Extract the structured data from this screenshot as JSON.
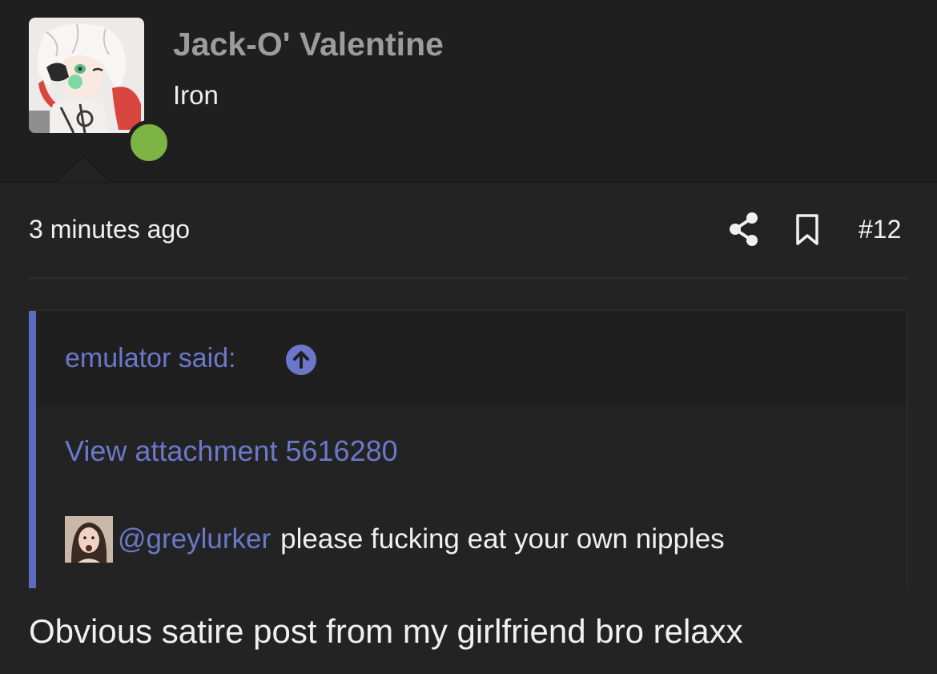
{
  "user": {
    "name": "Jack-O' Valentine",
    "title": "Iron",
    "status": "online",
    "status_color": "#7cb342",
    "avatar_icon": "anime-character-avatar"
  },
  "post": {
    "timestamp": "3 minutes ago",
    "number": "#12",
    "actions": [
      "share-icon",
      "bookmark-icon"
    ],
    "body": "Obvious satire post from my girlfriend bro relaxx"
  },
  "quote": {
    "author_label": "emulator said:",
    "jump_icon": "arrow-up-circle-icon",
    "attachment_link": "View attachment 5616280",
    "mention": "@greylurker",
    "message": "please fucking eat your own nipples"
  },
  "colors": {
    "background": "#232324",
    "header_background": "#1f1f20",
    "link": "#6b78c9",
    "quote_bar": "#5c6bc0",
    "username": "#9c9c9c"
  }
}
